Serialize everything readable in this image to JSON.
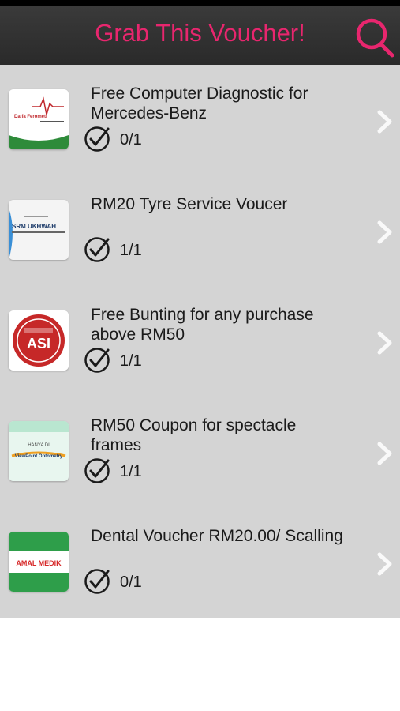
{
  "app": {
    "title": "Grab This Voucher!",
    "accent_color": "#e8266e",
    "search_icon": "search-icon"
  },
  "vouchers": [
    {
      "title": "Free Computer Diagnostic for Mercedes-Benz",
      "count": "0/1",
      "logo_text": "Dalfa Ferometi"
    },
    {
      "title": "RM20 Tyre Service Voucer",
      "count": "1/1",
      "logo_text": "SRM UKHWAH"
    },
    {
      "title": "Free Bunting for any purchase above RM50",
      "count": "1/1",
      "logo_text": "ASI"
    },
    {
      "title": "RM50 Coupon for spectacle frames",
      "count": "1/1",
      "logo_text": "ViewPoint Optometry",
      "logo_subtext": "HANYA DI"
    },
    {
      "title": "Dental Voucher RM20.00/ Scalling",
      "count": "0/1",
      "logo_text": "AMAL MEDIK"
    }
  ]
}
